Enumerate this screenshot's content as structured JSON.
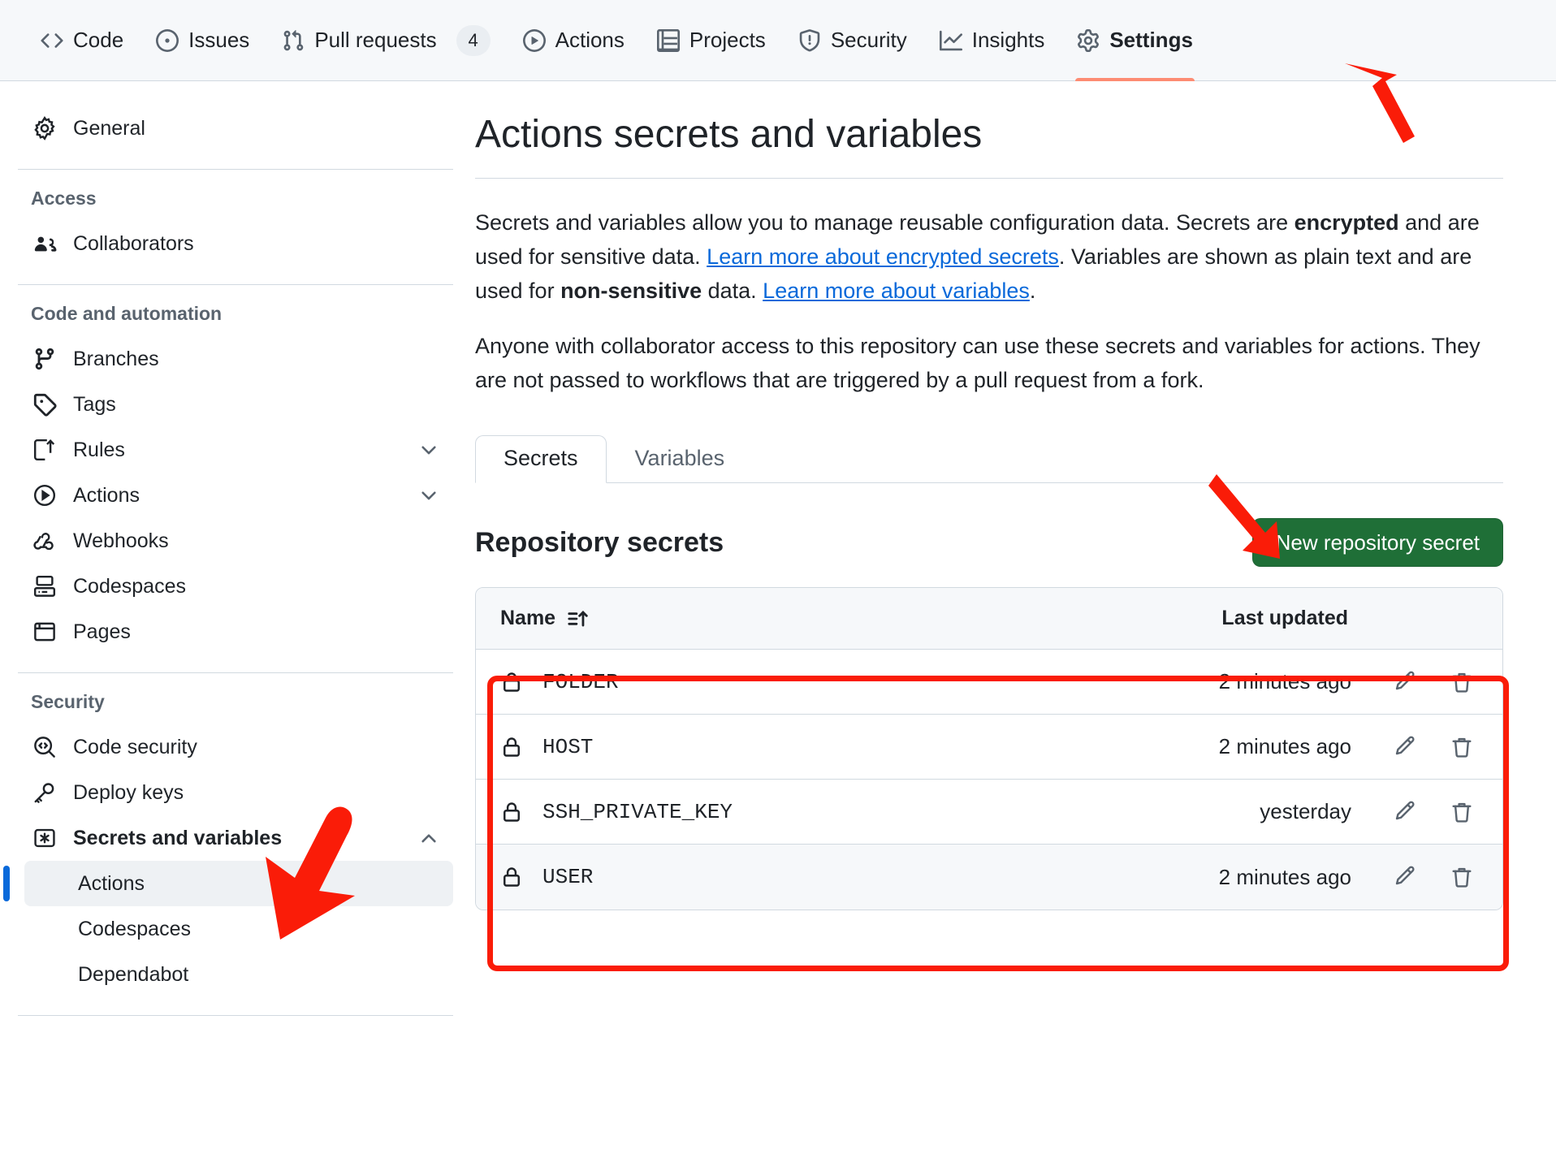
{
  "repo_nav": {
    "items": [
      {
        "label": "Code",
        "icon": "code-icon",
        "active": false,
        "counter": null
      },
      {
        "label": "Issues",
        "icon": "issue-opened-icon",
        "active": false,
        "counter": null
      },
      {
        "label": "Pull requests",
        "icon": "git-pull-request-icon",
        "active": false,
        "counter": "4"
      },
      {
        "label": "Actions",
        "icon": "play-icon",
        "active": false,
        "counter": null
      },
      {
        "label": "Projects",
        "icon": "table-icon",
        "active": false,
        "counter": null
      },
      {
        "label": "Security",
        "icon": "shield-icon",
        "active": false,
        "counter": null
      },
      {
        "label": "Insights",
        "icon": "graph-icon",
        "active": false,
        "counter": null
      },
      {
        "label": "Settings",
        "icon": "gear-icon",
        "active": true,
        "counter": null
      }
    ],
    "active_underline_color": "#fd8c73"
  },
  "sidebar": {
    "general": {
      "label": "General",
      "icon": "gear-icon"
    },
    "groups": [
      {
        "heading": "Access",
        "items": [
          {
            "label": "Collaborators",
            "icon": "people-icon",
            "chevron": null
          }
        ]
      },
      {
        "heading": "Code and automation",
        "items": [
          {
            "label": "Branches",
            "icon": "git-branch-icon",
            "chevron": null
          },
          {
            "label": "Tags",
            "icon": "tag-icon",
            "chevron": null
          },
          {
            "label": "Rules",
            "icon": "rules-icon",
            "chevron": "chevron-down-icon"
          },
          {
            "label": "Actions",
            "icon": "play-icon",
            "chevron": "chevron-down-icon"
          },
          {
            "label": "Webhooks",
            "icon": "webhook-icon",
            "chevron": null
          },
          {
            "label": "Codespaces",
            "icon": "codespaces-icon",
            "chevron": null
          },
          {
            "label": "Pages",
            "icon": "browser-icon",
            "chevron": null
          }
        ]
      },
      {
        "heading": "Security",
        "items": [
          {
            "label": "Code security",
            "icon": "codescan-icon",
            "chevron": null
          },
          {
            "label": "Deploy keys",
            "icon": "key-icon",
            "chevron": null
          },
          {
            "label": "Secrets and variables",
            "icon": "asterisk-icon",
            "chevron": "chevron-up-icon",
            "bold": true
          }
        ],
        "sub_items": [
          {
            "label": "Actions",
            "active": true
          },
          {
            "label": "Codespaces",
            "active": false
          },
          {
            "label": "Dependabot",
            "active": false
          }
        ]
      }
    ],
    "active_marker_color": "#0969da",
    "active_bg_color": "#eef1f4"
  },
  "main": {
    "title": "Actions secrets and variables",
    "paragraph1": {
      "part1": "Secrets and variables allow you to manage reusable configuration data. Secrets are ",
      "bold1": "encrypted",
      "part2": " and are used for sensitive data. ",
      "link1": "Learn more about encrypted secrets",
      "part3": ". Variables are shown as plain text and are used for ",
      "bold2": "non-sensitive",
      "part4": " data. ",
      "link2": "Learn more about variables",
      "part5": "."
    },
    "paragraph2": "Anyone with collaborator access to this repository can use these secrets and variables for actions. They are not passed to workflows that are triggered by a pull request from a fork.",
    "tabs": [
      {
        "label": "Secrets",
        "active": true
      },
      {
        "label": "Variables",
        "active": false
      }
    ],
    "section_title": "Repository secrets",
    "new_secret_button": "New repository secret",
    "new_secret_button_color": "#1f6f37",
    "table": {
      "columns": [
        {
          "label": "Name",
          "sort_icon": "sort-asc-icon"
        },
        {
          "label": "Last updated"
        }
      ],
      "rows": [
        {
          "name": "FOLDER",
          "updated": "2 minutes ago",
          "icon": "lock-icon",
          "edit": "pencil-icon",
          "delete": "trash-icon",
          "alt": false
        },
        {
          "name": "HOST",
          "updated": "2 minutes ago",
          "icon": "lock-icon",
          "edit": "pencil-icon",
          "delete": "trash-icon",
          "alt": false
        },
        {
          "name": "SSH_PRIVATE_KEY",
          "updated": "yesterday",
          "icon": "lock-icon",
          "edit": "pencil-icon",
          "delete": "trash-icon",
          "alt": false
        },
        {
          "name": "USER",
          "updated": "2 minutes ago",
          "icon": "lock-icon",
          "edit": "pencil-icon",
          "delete": "trash-icon",
          "alt": true
        }
      ]
    }
  },
  "annotations": {
    "color": "#fa1c08",
    "arrows": [
      {
        "name": "arrow-to-settings-tab",
        "points_to": "Settings"
      },
      {
        "name": "arrow-to-new-repository-secret-button",
        "points_to": "New repository secret"
      },
      {
        "name": "arrow-to-secrets-and-variables",
        "points_to": "Secrets and variables"
      }
    ],
    "highlight_box": {
      "name": "secrets-table-rows-highlight",
      "surrounds": "secrets table rows"
    }
  }
}
